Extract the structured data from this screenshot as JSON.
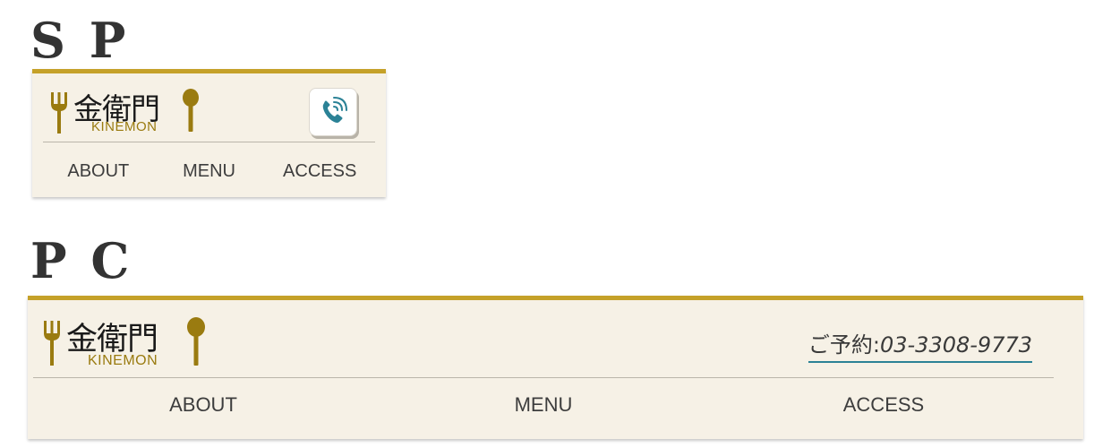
{
  "sp": {
    "heading": "S P",
    "logo": {
      "kanji": "金衛門",
      "roman": "KINEMON"
    },
    "nav": [
      {
        "label": "ABOUT"
      },
      {
        "label": "MENU"
      },
      {
        "label": "ACCESS"
      }
    ]
  },
  "pc": {
    "heading": "P C",
    "logo": {
      "kanji": "金衛門",
      "roman": "KINEMON"
    },
    "reservation": {
      "label": "ご予約:",
      "number": "03-3308-9773"
    },
    "nav": [
      {
        "label": "ABOUT"
      },
      {
        "label": "MENU"
      },
      {
        "label": "ACCESS"
      }
    ]
  },
  "icons": {
    "logo_left": "fork-icon",
    "logo_right": "spoon-icon",
    "phone": "phone-icon"
  },
  "colors": {
    "accent_gold": "#c5a129",
    "logo_brown": "#9a7b10",
    "panel_background": "#f6f1e6",
    "phone_teal": "#2b8296",
    "text": "#3d3d3d"
  }
}
